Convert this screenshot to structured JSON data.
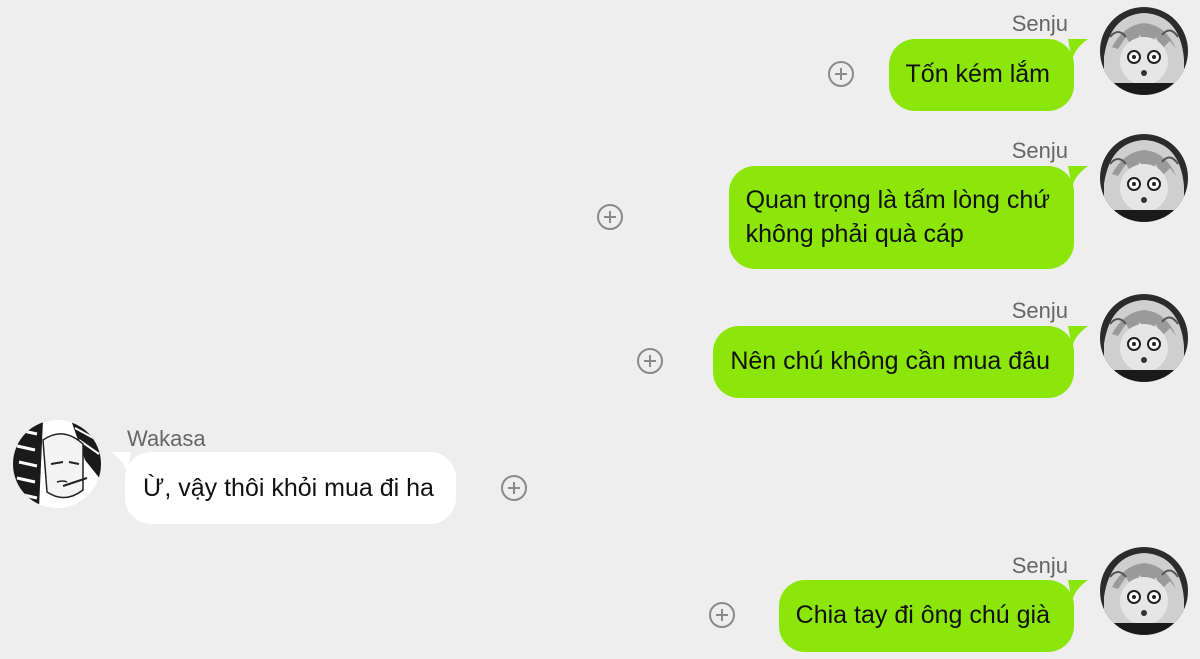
{
  "conversation": {
    "messages": [
      {
        "sender": "Senju",
        "side": "right",
        "lines": [
          "Tốn kém lắm"
        ]
      },
      {
        "sender": "Senju",
        "side": "right",
        "lines": [
          "Quan trọng là tấm lòng chứ",
          "không phải quà cáp"
        ]
      },
      {
        "sender": "Senju",
        "side": "right",
        "lines": [
          "Nên chú không cần mua đâu"
        ]
      },
      {
        "sender": "Wakasa",
        "side": "left",
        "lines": [
          "Ừ, vậy thôi khỏi mua đi ha"
        ]
      },
      {
        "sender": "Senju",
        "side": "right",
        "lines": [
          "Chia tay đi ông chú già"
        ]
      }
    ]
  },
  "colors": {
    "background": "#eeeeee",
    "sent_bubble": "#8de60a",
    "received_bubble": "#ffffff",
    "sender_name": "#666666",
    "add_icon": "#8a8a8a"
  },
  "icons": {
    "add_reaction": "circle-plus-icon",
    "avatar_senju": "manga-avatar-senju",
    "avatar_wakasa": "manga-avatar-wakasa"
  }
}
